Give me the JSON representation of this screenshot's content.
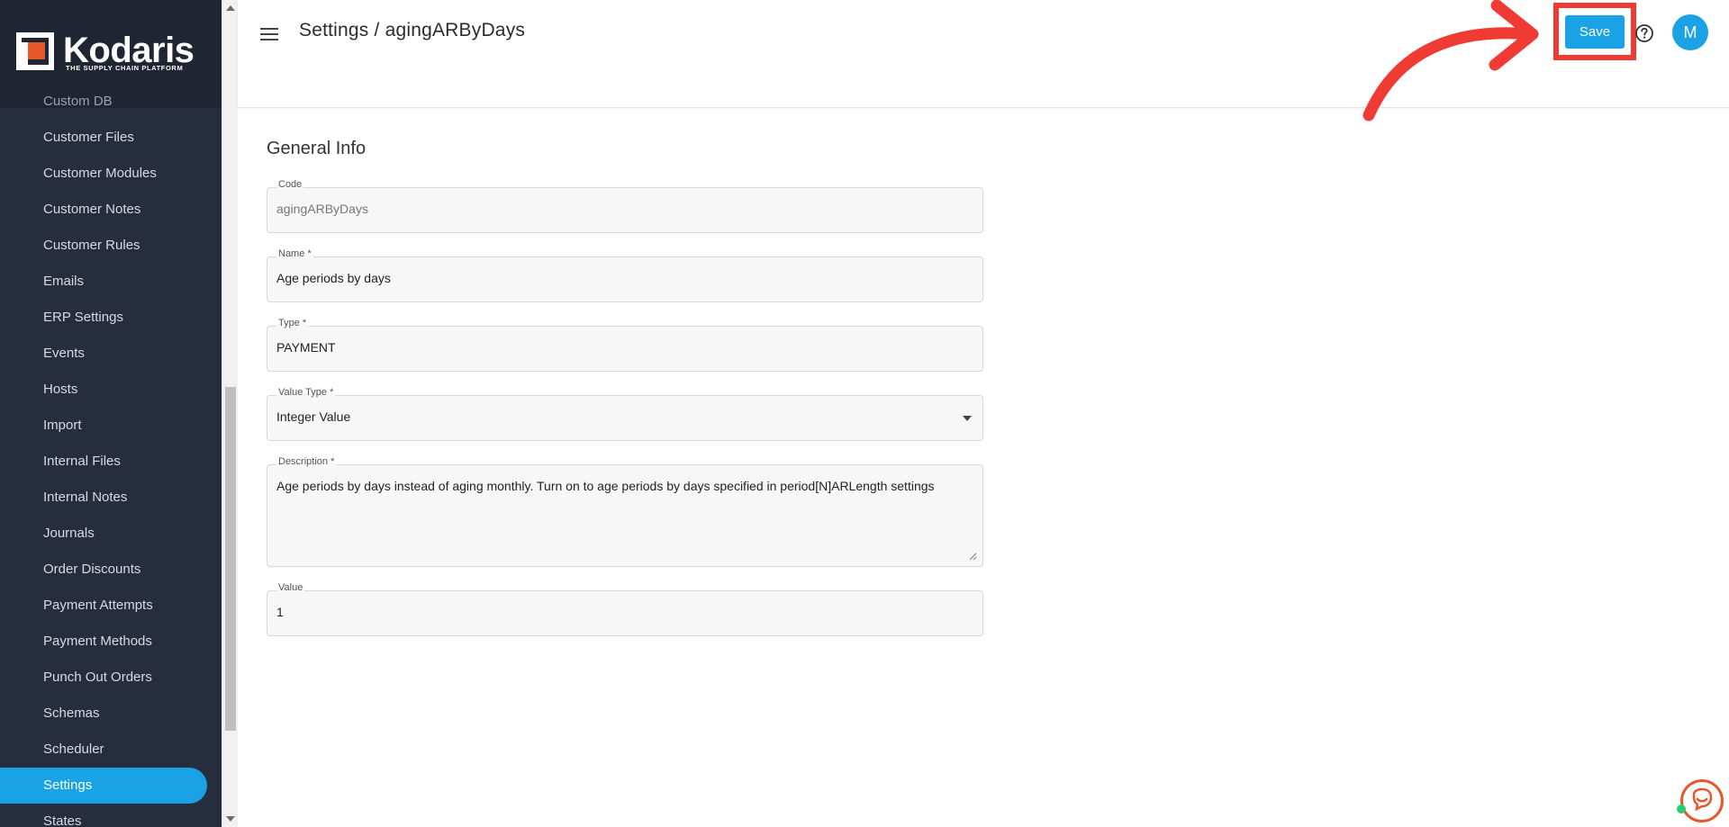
{
  "brand": {
    "name": "Kodaris",
    "tagline": "THE SUPPLY CHAIN PLATFORM",
    "accent_color": "#1aa2e6",
    "sidebar_color": "#262d3c"
  },
  "sidebar": {
    "items": [
      {
        "label": "Custom DB",
        "state": "partial"
      },
      {
        "label": "Customer Files"
      },
      {
        "label": "Customer Modules"
      },
      {
        "label": "Customer Notes"
      },
      {
        "label": "Customer Rules"
      },
      {
        "label": "Emails"
      },
      {
        "label": "ERP Settings"
      },
      {
        "label": "Events"
      },
      {
        "label": "Hosts"
      },
      {
        "label": "Import"
      },
      {
        "label": "Internal Files"
      },
      {
        "label": "Internal Notes"
      },
      {
        "label": "Journals"
      },
      {
        "label": "Order Discounts"
      },
      {
        "label": "Payment Attempts"
      },
      {
        "label": "Payment Methods"
      },
      {
        "label": "Punch Out Orders"
      },
      {
        "label": "Schemas"
      },
      {
        "label": "Scheduler"
      },
      {
        "label": "Settings",
        "state": "active"
      },
      {
        "label": "States"
      }
    ]
  },
  "header": {
    "title": "Settings / agingARByDays",
    "save_label": "Save",
    "avatar_initial": "M",
    "annotation_color": "#ef3b34"
  },
  "main": {
    "section_title": "General Info",
    "fields": {
      "code": {
        "label": "Code",
        "value": "agingARByDays"
      },
      "name": {
        "label": "Name *",
        "value": "Age periods by days"
      },
      "type": {
        "label": "Type *",
        "value": "PAYMENT"
      },
      "value_type": {
        "label": "Value Type *",
        "value": "Integer Value"
      },
      "description": {
        "label": "Description *",
        "value": "Age periods by days instead of aging monthly. Turn on to age periods by days specified in period[N]ARLength settings"
      },
      "value": {
        "label": "Value",
        "value": "1"
      }
    }
  }
}
